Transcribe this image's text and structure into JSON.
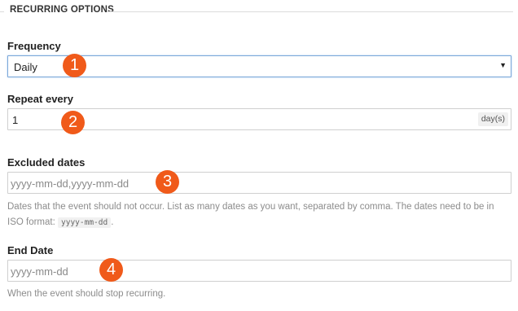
{
  "fieldset": {
    "legend": "RECURRING OPTIONS"
  },
  "frequency": {
    "label": "Frequency",
    "selected": "Daily",
    "caret_icon": "triangle-down"
  },
  "repeat_every": {
    "label": "Repeat every",
    "value": "1",
    "unit": "day(s)"
  },
  "excluded_dates": {
    "label": "Excluded dates",
    "placeholder": "yyyy-mm-dd,yyyy-mm-dd",
    "help_text": "Dates that the event should not occur. List as many dates as you want, separated by comma. The dates need to be in ISO format:",
    "help_code": "yyyy-mm-dd",
    "help_suffix": "."
  },
  "end_date": {
    "label": "End Date",
    "placeholder": "yyyy-mm-dd",
    "help_text": "When the event should stop recurring."
  },
  "annotations": {
    "badge_1": "1",
    "badge_2": "2",
    "badge_3": "3",
    "badge_4": "4",
    "color": "#f05a1a"
  }
}
